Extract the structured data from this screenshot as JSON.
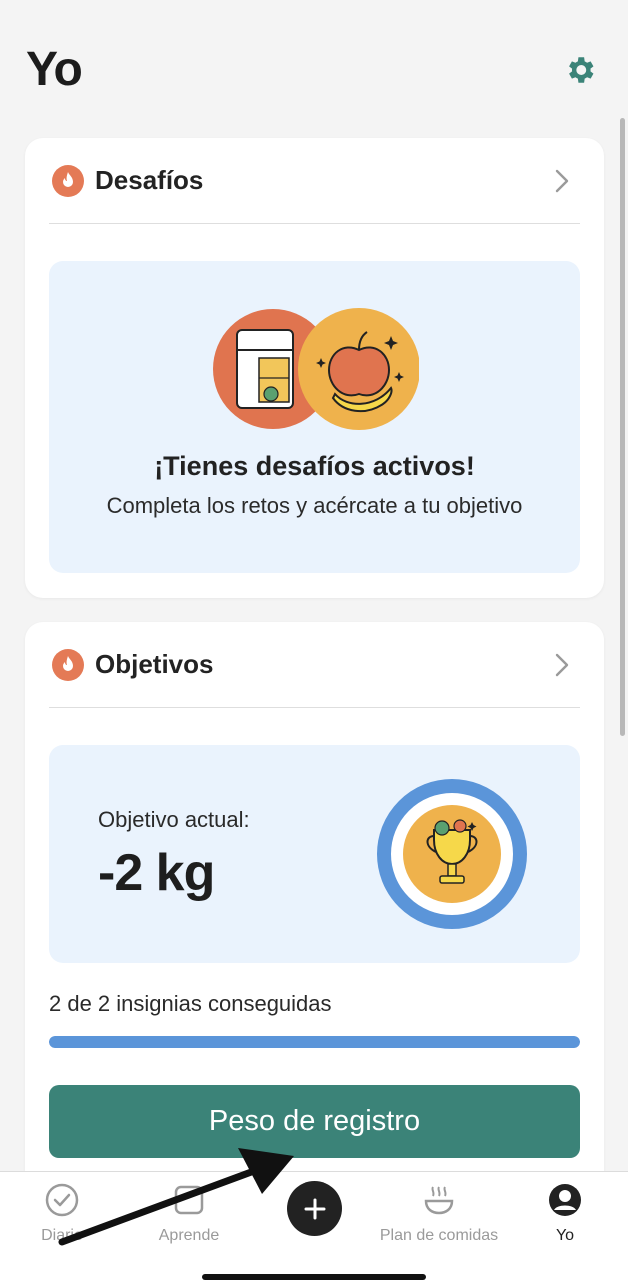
{
  "header": {
    "title": "Yo",
    "settings_icon": "gear-icon",
    "accent_color": "#3b8378"
  },
  "challenges": {
    "title": "Desafíos",
    "heading": "¡Tienes desafíos activos!",
    "subtitle": "Completa los retos y acércate a tu objetivo"
  },
  "goals": {
    "title": "Objetivos",
    "current_label": "Objetivo actual:",
    "current_value": "-2 kg",
    "badges_text": "2 de 2 insignias conseguidas",
    "badges_progress": 1.0,
    "button_label": "Peso de registro"
  },
  "tabbar": {
    "items": [
      {
        "label": "Diario",
        "icon": "check-circle-icon"
      },
      {
        "label": "Aprende",
        "icon": "book-icon"
      },
      {
        "label": "",
        "icon": "plus-icon"
      },
      {
        "label": "Plan de comidas",
        "icon": "bowl-icon"
      },
      {
        "label": "Yo",
        "icon": "profile-icon",
        "active": true
      }
    ]
  }
}
